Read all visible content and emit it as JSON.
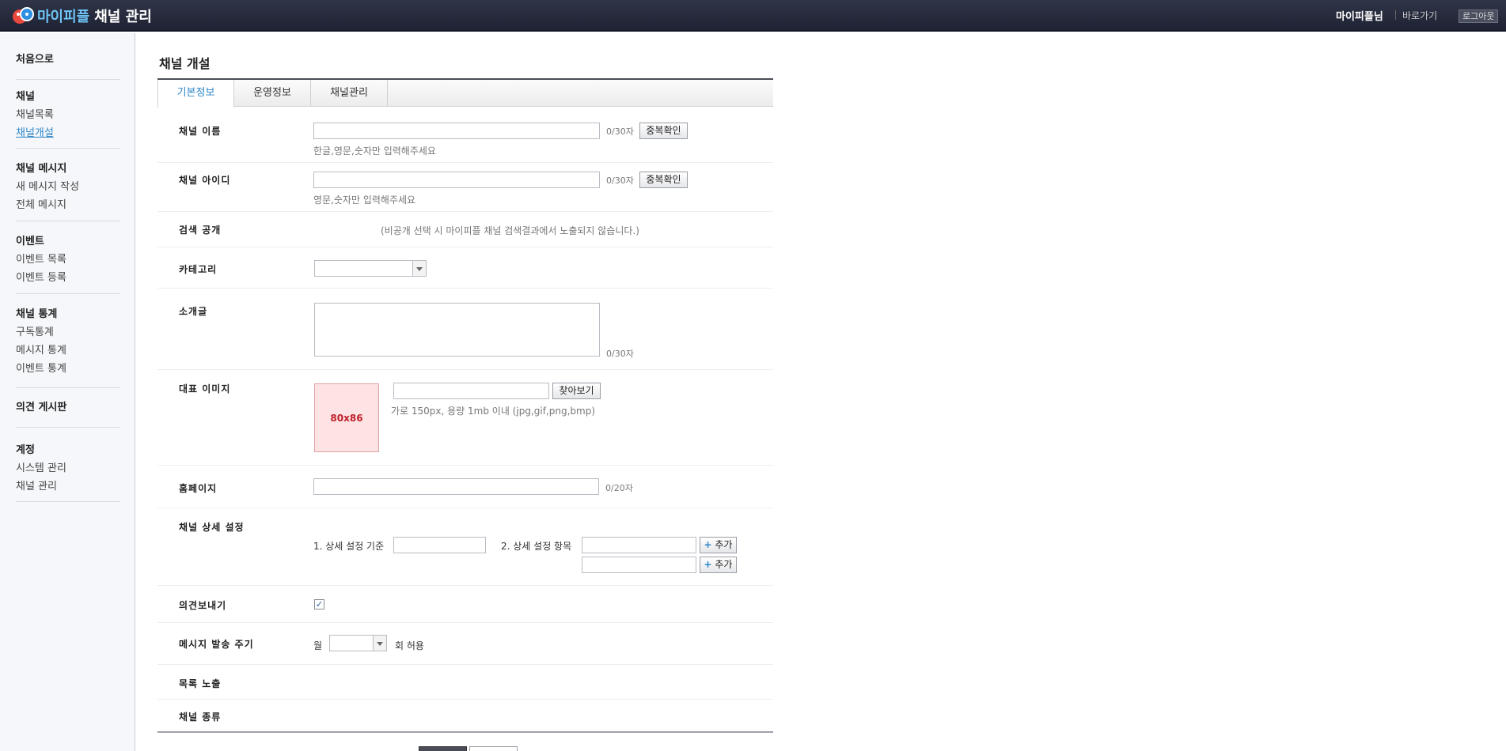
{
  "header": {
    "brand": "마이피플",
    "title": "채널 관리",
    "user": "마이피플님",
    "goto": "바로가기",
    "logout": "로그아웃"
  },
  "sidebar": {
    "home": "처음으로",
    "groups": [
      {
        "title": "채널",
        "items": [
          "채널목록",
          "채널개설"
        ]
      },
      {
        "title": "채널 메시지",
        "items": [
          "새 메시지 작성",
          "전체 메시지"
        ]
      },
      {
        "title": "이벤트",
        "items": [
          "이벤트 목록",
          "이벤트 등록"
        ]
      },
      {
        "title": "채널 통계",
        "items": [
          "구독통계",
          "메시지 통계",
          "이벤트 통계"
        ]
      },
      {
        "title": "의견 게시판",
        "items": []
      },
      {
        "title": "계정",
        "items": [
          "시스템 관리",
          "채널 관리"
        ]
      }
    ]
  },
  "main": {
    "page_title": "채널 개설",
    "tabs": [
      "기본정보",
      "운영정보",
      "채널관리"
    ],
    "fields": {
      "channel_name": {
        "label": "채널 이름",
        "count": "0/30자",
        "button": "중복확인",
        "hint": "한글,영문,숫자만 입력해주세요"
      },
      "channel_id": {
        "label": "채널 아이디",
        "count": "0/30자",
        "button": "중복확인",
        "hint": "영문,숫자만 입력해주세요"
      },
      "search_public": {
        "label": "검색 공개",
        "note": "(비공개 선택 시 마이피플 채널 검색결과에서 노출되지 않습니다.)"
      },
      "category": {
        "label": "카테고리"
      },
      "intro": {
        "label": "소개글",
        "count": "0/30자"
      },
      "image": {
        "label": "대표 이미지",
        "thumb": "80x86",
        "button": "찾아보기",
        "hint": "가로 150px, 용량 1mb 이내 (jpg,gif,png,bmp)"
      },
      "homepage": {
        "label": "홈페이지",
        "count": "0/20자"
      },
      "detail": {
        "label": "채널 상세 설정",
        "criteria_label": "1. 상세 설정 기준",
        "items_label": "2. 상세 설정 항목",
        "add": "추가",
        "plus": "+"
      },
      "feedback": {
        "label": "의견보내기",
        "checked": true,
        "check_mark": "✓"
      },
      "send_cycle": {
        "label": "메시지 발송 주기",
        "prefix": "월",
        "suffix": "회 허용"
      },
      "list_expose": {
        "label": "목록 노출"
      },
      "channel_type": {
        "label": "채널 종류"
      }
    }
  }
}
